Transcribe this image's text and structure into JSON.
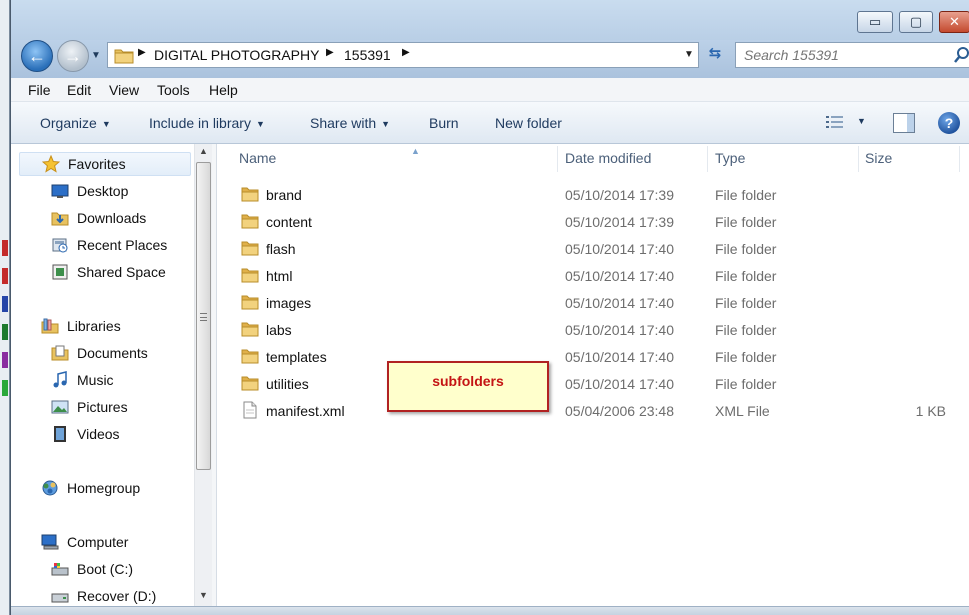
{
  "window": {
    "controls": {
      "minimize": "▭",
      "maximize": "▢",
      "close": "✕"
    }
  },
  "address": {
    "segments": [
      "DIGITAL PHOTOGRAPHY",
      "155391"
    ],
    "search_placeholder": "Search 155391"
  },
  "menu": [
    "File",
    "Edit",
    "View",
    "Tools",
    "Help"
  ],
  "commands": {
    "organize": "Organize",
    "include_in_library": "Include in library",
    "share_with": "Share with",
    "burn": "Burn",
    "new_folder": "New folder"
  },
  "nav": {
    "favorites": "Favorites",
    "favorites_items": [
      "Desktop",
      "Downloads",
      "Recent Places",
      "Shared Space"
    ],
    "libraries": "Libraries",
    "libraries_items": [
      "Documents",
      "Music",
      "Pictures",
      "Videos"
    ],
    "homegroup": "Homegroup",
    "computer": "Computer",
    "computer_items": [
      "Boot (C:)",
      "Recover (D:)"
    ]
  },
  "columns": {
    "name": "Name",
    "date": "Date modified",
    "type": "Type",
    "size": "Size"
  },
  "files": [
    {
      "name": "brand",
      "date": "05/10/2014 17:39",
      "type": "File folder",
      "size": "",
      "icon": "folder-icon"
    },
    {
      "name": "content",
      "date": "05/10/2014 17:39",
      "type": "File folder",
      "size": "",
      "icon": "folder-icon"
    },
    {
      "name": "flash",
      "date": "05/10/2014 17:40",
      "type": "File folder",
      "size": "",
      "icon": "folder-icon"
    },
    {
      "name": "html",
      "date": "05/10/2014 17:40",
      "type": "File folder",
      "size": "",
      "icon": "folder-icon"
    },
    {
      "name": "images",
      "date": "05/10/2014 17:40",
      "type": "File folder",
      "size": "",
      "icon": "folder-icon"
    },
    {
      "name": "labs",
      "date": "05/10/2014 17:40",
      "type": "File folder",
      "size": "",
      "icon": "folder-icon"
    },
    {
      "name": "templates",
      "date": "05/10/2014 17:40",
      "type": "File folder",
      "size": "",
      "icon": "folder-icon"
    },
    {
      "name": "utilities",
      "date": "05/10/2014 17:40",
      "type": "File folder",
      "size": "",
      "icon": "folder-icon"
    },
    {
      "name": "manifest.xml",
      "date": "05/04/2006 23:48",
      "type": "XML File",
      "size": "1 KB",
      "icon": "xml-file-icon"
    }
  ],
  "callout": "subfolders",
  "colors": {
    "accent": "#2a6fb9",
    "folder": "#e8c260",
    "callout_border": "#b12222",
    "callout_text": "#c41414",
    "callout_bg": "#ffffcc"
  }
}
